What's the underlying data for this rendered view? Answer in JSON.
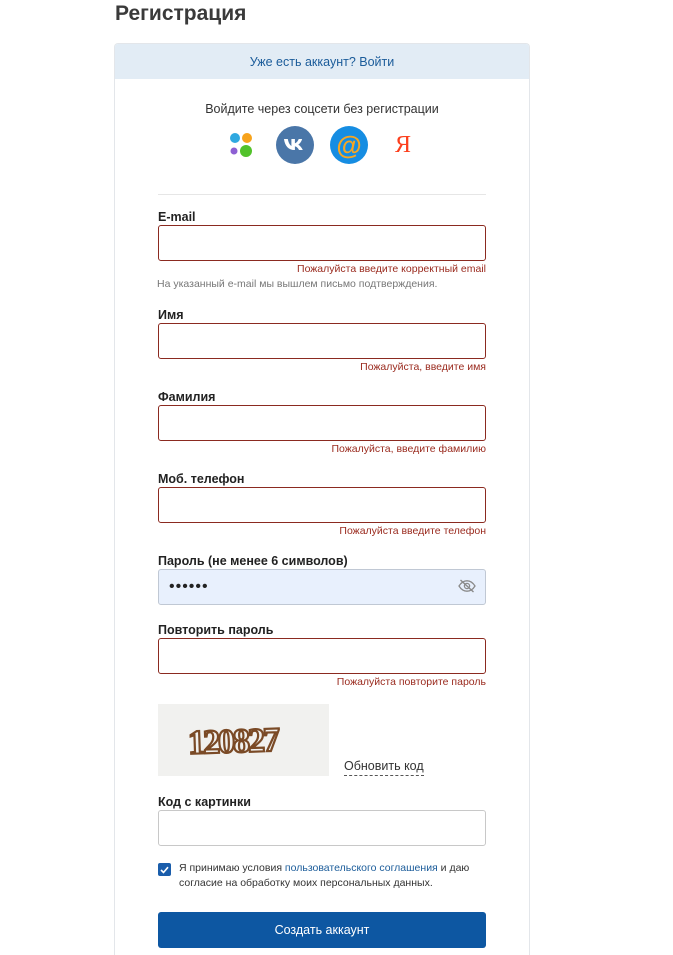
{
  "page": {
    "title": "Регистрация"
  },
  "login_bar": {
    "text": "Уже есть аккаунт? Войти"
  },
  "social": {
    "caption": "Войдите через соцсети без регистрации",
    "providers": [
      {
        "name": "multi-dot-icon"
      },
      {
        "name": "vk-icon",
        "glyph": "vk",
        "color": "#4a76a8"
      },
      {
        "name": "mail-at-icon",
        "glyph": "@",
        "color": "#168de2"
      },
      {
        "name": "yandex-icon",
        "glyph": "Я",
        "color": "#fc3f1d"
      }
    ]
  },
  "fields": {
    "email": {
      "label": "E-mail",
      "value": "",
      "error": "Пожалуйста введите корректный email",
      "hint": "На указанный e-mail мы вышлем письмо подтверждения."
    },
    "first_name": {
      "label": "Имя",
      "value": "",
      "error": "Пожалуйста, введите имя"
    },
    "last_name": {
      "label": "Фамилия",
      "value": "",
      "error": "Пожалуйста, введите фамилию"
    },
    "phone": {
      "label": "Моб. телефон",
      "value": "",
      "error": "Пожалуйста введите телефон"
    },
    "password": {
      "label": "Пароль (не менее 6 символов)",
      "value": "••••••"
    },
    "password_repeat": {
      "label": "Повторить пароль",
      "value": "",
      "error": "Пожалуйста повторите пароль"
    },
    "captcha": {
      "label": "Код с картинки",
      "value": ""
    }
  },
  "captcha": {
    "image_text": "120827",
    "refresh": "Обновить код"
  },
  "agreement": {
    "checked": true,
    "before": "Я принимаю условия ",
    "link": "пользовательского соглашения",
    "after": " и даю согласие на обработку моих персональных данных."
  },
  "submit": {
    "label": "Создать аккаунт"
  },
  "colors": {
    "accent": "#0d57a2",
    "error": "#9a2a1e",
    "login_bar_bg": "#e2ecf5"
  }
}
